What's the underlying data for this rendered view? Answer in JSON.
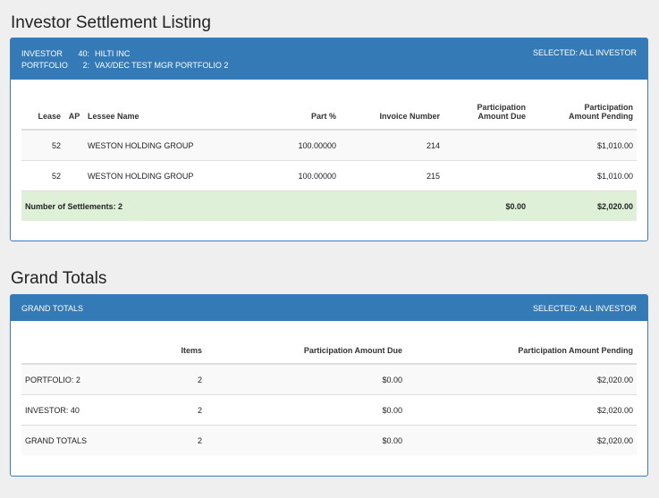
{
  "listing": {
    "title": "Investor Settlement Listing",
    "header": {
      "investor_label": "INVESTOR",
      "investor_num": "40:",
      "investor_name": "HILTI INC",
      "portfolio_label": "PORTFOLIO",
      "portfolio_num": "2:",
      "portfolio_name": "VAX/DEC TEST MGR PORTFOLIO 2",
      "selected": "SELECTED: ALL INVESTOR"
    },
    "columns": {
      "lease": "Lease",
      "ap": "AP",
      "lessee": "Lessee Name",
      "part": "Part %",
      "invoice": "Invoice Number",
      "due_1": "Participation",
      "due_2": "Amount Due",
      "pending_1": "Participation",
      "pending_2": "Amount Pending"
    },
    "rows": [
      {
        "lease": "52",
        "ap": "",
        "lessee": "WESTON HOLDING GROUP",
        "part": "100.00000",
        "invoice": "214",
        "due": "",
        "pending": "$1,010.00"
      },
      {
        "lease": "52",
        "ap": "",
        "lessee": "WESTON HOLDING GROUP",
        "part": "100.00000",
        "invoice": "215",
        "due": "",
        "pending": "$1,010.00"
      }
    ],
    "total": {
      "label": "Number of Settlements: 2",
      "due": "$0.00",
      "pending": "$2,020.00"
    }
  },
  "grand": {
    "title": "Grand Totals",
    "header": {
      "label": "GRAND TOTALS",
      "selected": "SELECTED: ALL INVESTOR"
    },
    "columns": {
      "items": "Items",
      "due": "Participation Amount Due",
      "pending": "Participation Amount Pending"
    },
    "rows": [
      {
        "label": "PORTFOLIO: 2",
        "items": "2",
        "due": "$0.00",
        "pending": "$2,020.00"
      },
      {
        "label": "INVESTOR: 40",
        "items": "2",
        "due": "$0.00",
        "pending": "$2,020.00"
      },
      {
        "label": "GRAND TOTALS",
        "items": "2",
        "due": "$0.00",
        "pending": "$2,020.00"
      }
    ]
  }
}
